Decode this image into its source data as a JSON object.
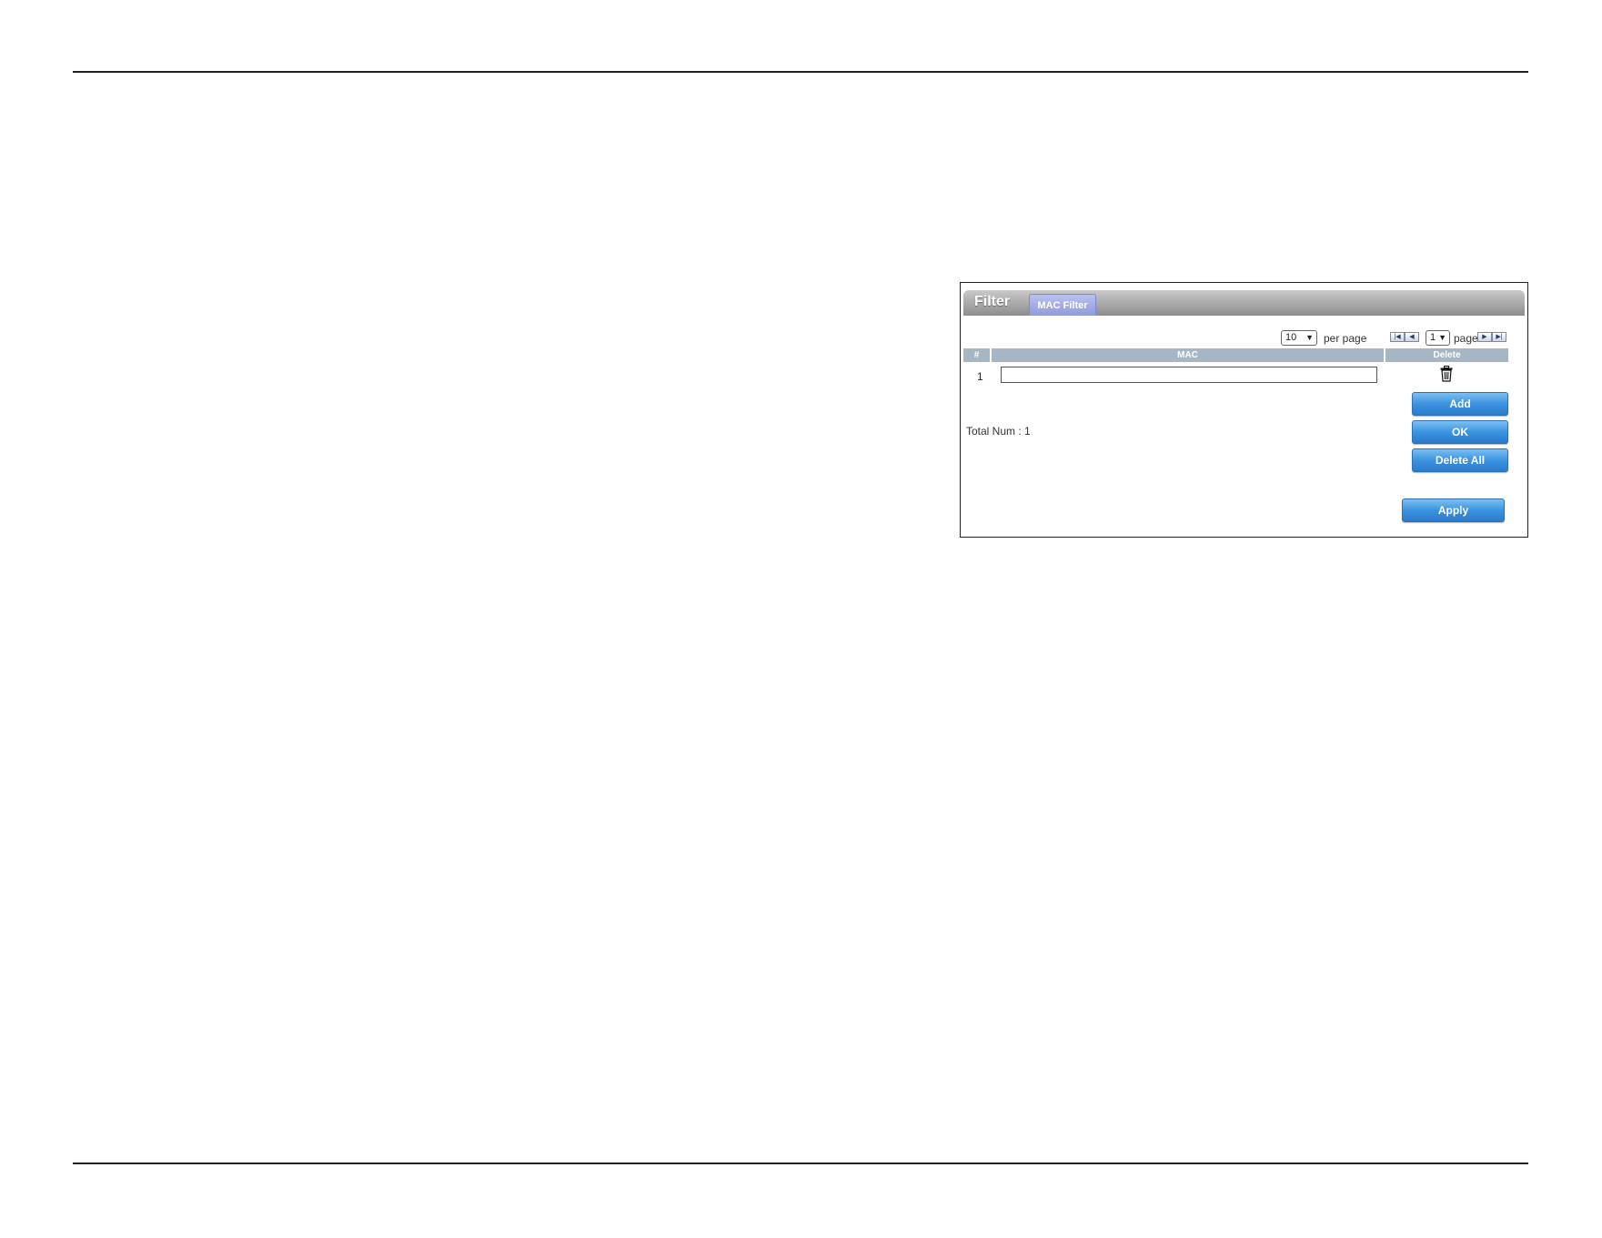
{
  "panel": {
    "title": "Filter",
    "tab_label": "MAC Filter"
  },
  "pager": {
    "per_page_value": "10",
    "per_page_label": "per page",
    "page_value": "1",
    "page_label": "page"
  },
  "table": {
    "headers": [
      "#",
      "MAC",
      "Delete"
    ],
    "rows": [
      {
        "num": "1",
        "mac": ""
      }
    ]
  },
  "total": "Total Num : 1",
  "buttons": {
    "add": "Add",
    "ok": "OK",
    "delete_all": "Delete All",
    "apply": "Apply"
  },
  "icons": {
    "trash": "trash-icon",
    "first": "first-page-icon",
    "prev": "prev-page-icon",
    "next": "next-page-icon",
    "last": "last-page-icon"
  },
  "colors": {
    "button_blue": "#3b93e0",
    "tab_purple": "#8f9bdc",
    "header_gray": "#a7b6c4"
  }
}
